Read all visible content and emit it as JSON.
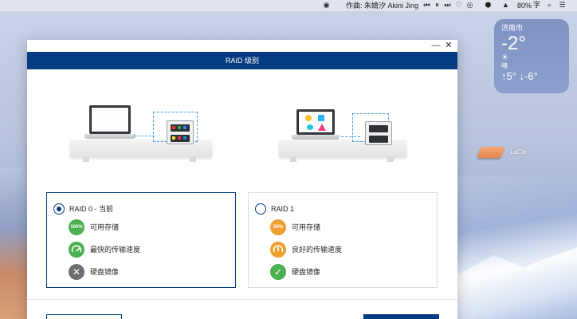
{
  "menubar": {
    "now_playing": "作曲: 朱婧汐 Akini Jing",
    "battery": "80%"
  },
  "weather": {
    "city": "济南市",
    "temperature": "-2°",
    "condition": "晴",
    "range": "↑5° ↓-6°"
  },
  "desktop": {
    "drive_label": "LaCie"
  },
  "dialog": {
    "title": "RAID 级别",
    "minimize_glyph": "—",
    "close_glyph": "✕",
    "options": [
      {
        "title": "RAID 0 - 当前",
        "selected": true,
        "features": [
          {
            "badge": "100%",
            "label": "可用存储",
            "color": "#4caf50",
            "icon": "percent-badge"
          },
          {
            "badge": "",
            "label": "最快的传输速度",
            "color": "#4caf50",
            "icon": "speedometer-icon"
          },
          {
            "badge": "✕",
            "label": "硬盘镜像",
            "color": "#6b6f75",
            "icon": "x-icon"
          }
        ]
      },
      {
        "title": "RAID 1",
        "selected": false,
        "features": [
          {
            "badge": "50%",
            "label": "可用存储",
            "color": "#f0a030",
            "icon": "percent-badge"
          },
          {
            "badge": "",
            "label": "良好的传输速度",
            "color": "#f0a030",
            "icon": "speedometer-icon"
          },
          {
            "badge": "✓",
            "label": "硬盘镜像",
            "color": "#4caf50",
            "icon": "check-icon"
          }
        ]
      }
    ]
  }
}
